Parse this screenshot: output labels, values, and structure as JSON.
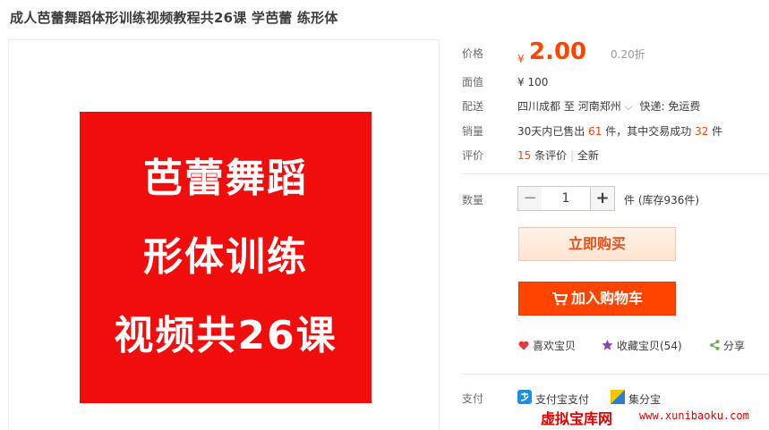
{
  "product": {
    "title": "成人芭蕾舞蹈体形训练视频教程共26课 学芭蕾 练形体",
    "hero_lines": [
      "芭蕾舞蹈",
      "形体训练",
      "视频共26课"
    ]
  },
  "details": {
    "price_label": "价格",
    "currency": "¥",
    "price": "2.00",
    "discount": "0.20折",
    "face_value_label": "面值",
    "face_value": "¥ 100",
    "shipping_label": "配送",
    "shipping_from": "四川成都",
    "shipping_to_word": "至",
    "shipping_to": "河南郑州",
    "shipping_method": "快递: 免运费",
    "sales_label": "销量",
    "sales_prefix": "30天内已售出",
    "sales_count": "61",
    "sales_middle": "件，其中交易成功",
    "sales_success": "32",
    "sales_suffix": "件",
    "review_label": "评价",
    "review_count": "15",
    "review_suffix": "条评价",
    "review_sep": "|",
    "review_new": "全新"
  },
  "purchase": {
    "qty_label": "数量",
    "qty_minus": "−",
    "qty_value": "1",
    "qty_plus": "+",
    "stock_text": "件 (库存936件)",
    "buy_now_label": "立即购买",
    "add_cart_label": "加入购物车"
  },
  "actions": {
    "like_label": "喜欢宝贝",
    "favorite_label": "收藏宝贝(54)",
    "share_label": "分享"
  },
  "payment": {
    "label": "支付",
    "alipay_label": "支付宝支付",
    "jifen_label": "集分宝"
  },
  "watermark": {
    "text": "虚拟宝库网",
    "url": "www.xunibaoku.com"
  },
  "colors": {
    "accent": "#ff4400",
    "hero_bg": "#f20d0d"
  }
}
